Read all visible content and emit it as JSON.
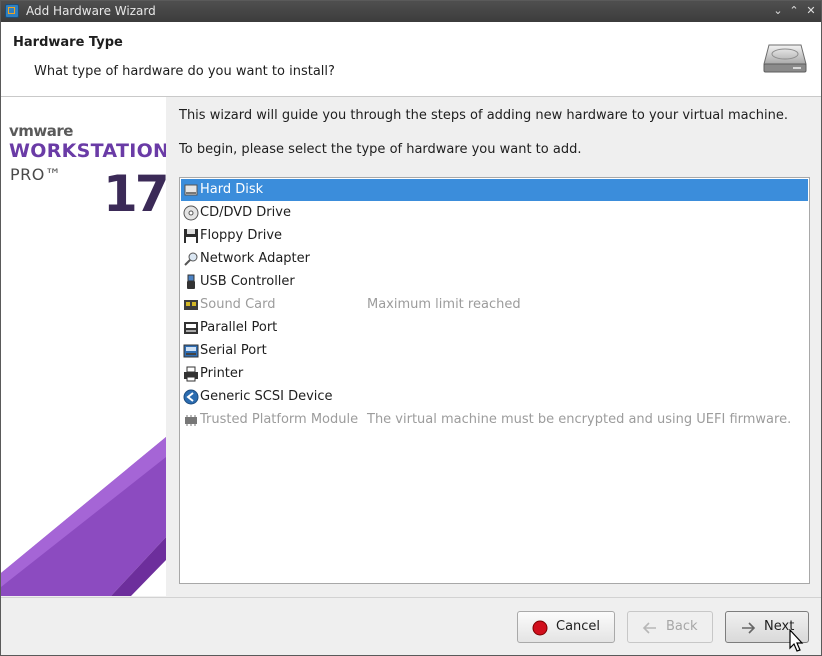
{
  "window": {
    "title": "Add Hardware Wizard",
    "controls": [
      "⌄",
      "⌃",
      "✕"
    ]
  },
  "header": {
    "title": "Hardware Type",
    "subtitle": "What type of hardware do you want to install?",
    "icon": "hard-disk-icon"
  },
  "branding": {
    "vendor": "vmware",
    "product": "WORKSTATION",
    "edition": "PRO™",
    "version": "17",
    "colors": {
      "purple": "#6a3ba6",
      "deep_purple": "#3b2a57"
    }
  },
  "content": {
    "intro": "This wizard will guide you through the steps of adding new hardware to your virtual machine.",
    "prompt": "To begin, please select the type of hardware you want to add."
  },
  "hardware_list": {
    "items": [
      {
        "label": "Hard Disk",
        "icon": "hard-disk-icon",
        "note": "",
        "state": "selected"
      },
      {
        "label": "CD/DVD Drive",
        "icon": "cd-dvd-icon",
        "note": "",
        "state": "enabled"
      },
      {
        "label": "Floppy Drive",
        "icon": "floppy-icon",
        "note": "",
        "state": "enabled"
      },
      {
        "label": "Network Adapter",
        "icon": "network-adapter-icon",
        "note": "",
        "state": "enabled"
      },
      {
        "label": "USB Controller",
        "icon": "usb-icon",
        "note": "",
        "state": "enabled"
      },
      {
        "label": "Sound Card",
        "icon": "sound-card-icon",
        "note": "Maximum limit reached",
        "state": "disabled"
      },
      {
        "label": "Parallel Port",
        "icon": "parallel-port-icon",
        "note": "",
        "state": "enabled"
      },
      {
        "label": "Serial Port",
        "icon": "serial-port-icon",
        "note": "",
        "state": "enabled"
      },
      {
        "label": "Printer",
        "icon": "printer-icon",
        "note": "",
        "state": "enabled"
      },
      {
        "label": "Generic SCSI Device",
        "icon": "scsi-icon",
        "note": "",
        "state": "enabled"
      },
      {
        "label": "Trusted Platform Module",
        "icon": "tpm-icon",
        "note": "The virtual machine must be encrypted and using UEFI firmware.",
        "state": "disabled"
      }
    ],
    "selection_color": "#3b8ddb"
  },
  "buttons": {
    "cancel": {
      "label": "Cancel",
      "icon": "stop-icon",
      "enabled": true
    },
    "back": {
      "label": "Back",
      "icon": "back-arrow-icon",
      "enabled": false
    },
    "next": {
      "label": "Next",
      "icon": "next-arrow-icon",
      "enabled": true
    }
  }
}
